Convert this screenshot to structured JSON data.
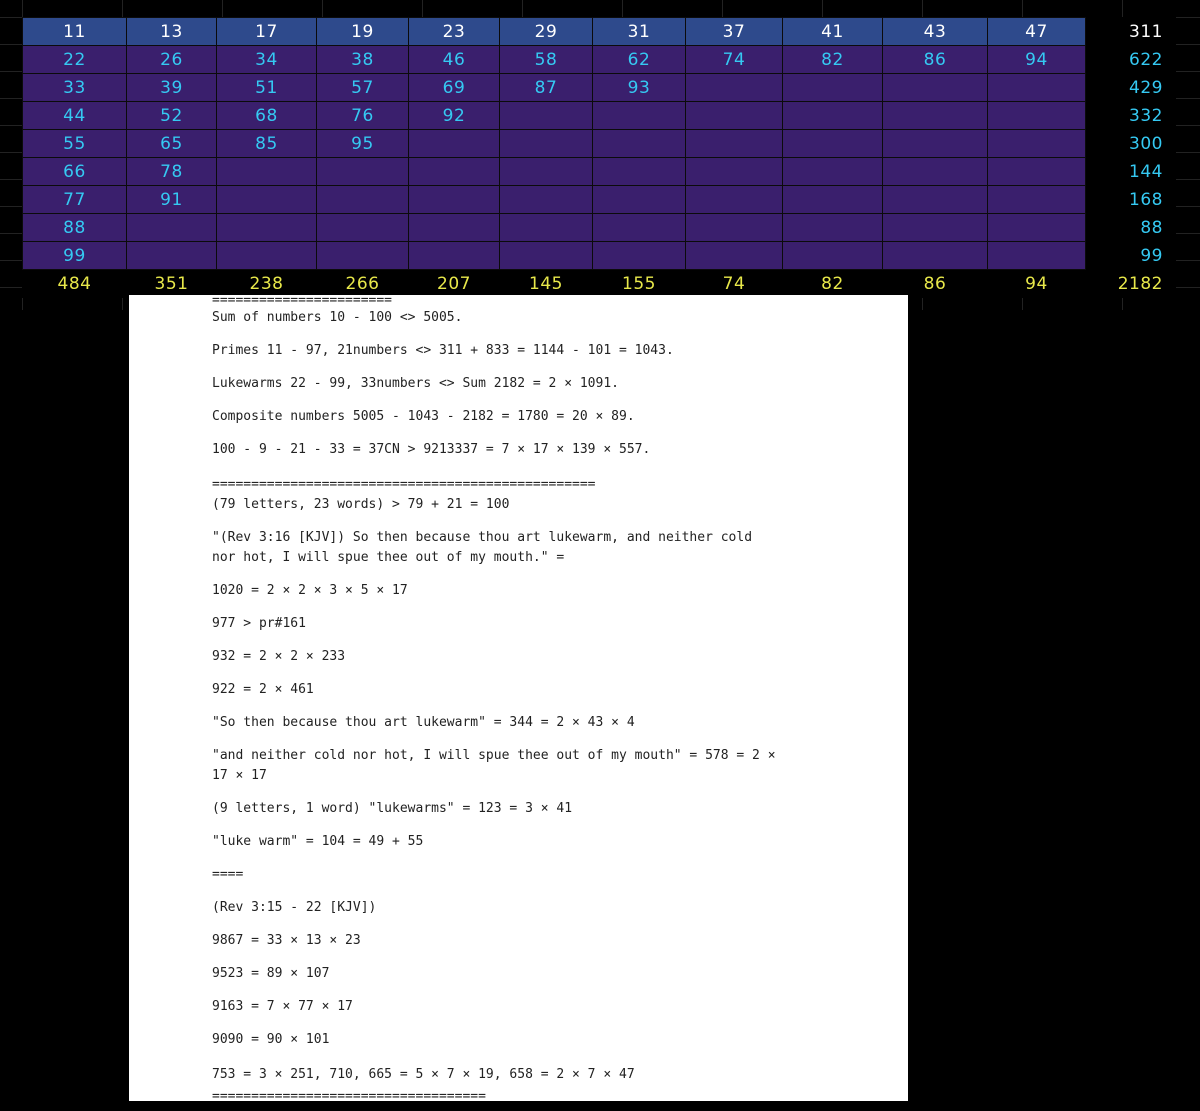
{
  "sheet": {
    "header": [
      "11",
      "13",
      "17",
      "19",
      "23",
      "29",
      "31",
      "37",
      "41",
      "43",
      "47",
      "311"
    ],
    "rows": [
      [
        "22",
        "26",
        "34",
        "38",
        "46",
        "58",
        "62",
        "74",
        "82",
        "86",
        "94",
        "622"
      ],
      [
        "33",
        "39",
        "51",
        "57",
        "69",
        "87",
        "93",
        "",
        "",
        "",
        "",
        "429"
      ],
      [
        "44",
        "52",
        "68",
        "76",
        "92",
        "",
        "",
        "",
        "",
        "",
        "",
        "332"
      ],
      [
        "55",
        "65",
        "85",
        "95",
        "",
        "",
        "",
        "",
        "",
        "",
        "",
        "300"
      ],
      [
        "66",
        "78",
        "",
        "",
        "",
        "",
        "",
        "",
        "",
        "",
        "",
        "144"
      ],
      [
        "77",
        "91",
        "",
        "",
        "",
        "",
        "",
        "",
        "",
        "",
        "",
        "168"
      ],
      [
        "88",
        "",
        "",
        "",
        "",
        "",
        "",
        "",
        "",
        "",
        "",
        "88"
      ],
      [
        "99",
        "",
        "",
        "",
        "",
        "",
        "",
        "",
        "",
        "",
        "",
        "99"
      ]
    ],
    "sums": [
      "484",
      "351",
      "238",
      "266",
      "207",
      "145",
      "155",
      "74",
      "82",
      "86",
      "94",
      "2182"
    ]
  },
  "doc": {
    "lines": [
      "=======================",
      "Sum of numbers 10 - 100 <> 5005.",
      "Primes 11 - 97, 21numbers <> 311 + 833 = 1144 - 101 = 1043.",
      "Lukewarms 22 - 99, 33numbers <> Sum 2182 = 2 × 1091.",
      "Composite numbers 5005 - 1043 - 2182 = 1780 = 20 × 89.",
      "100 - 9 - 21 - 33 = 37CN > 9213337 = 7 × 17 × 139 × 557.",
      "=================================================",
      "(79 letters, 23 words) > 79 + 21 = 100",
      "\"(Rev 3:16 [KJV]) So then because thou art lukewarm, and neither cold",
      "nor hot, I will spue thee out of my mouth.\" =",
      "1020 = 2 × 2 × 3 × 5 × 17",
      "977 > pr#161",
      "932 = 2 × 2 × 233",
      "922 = 2 × 461",
      "\"So then because thou art lukewarm\" = 344 = 2 × 43 × 4",
      "\"and neither cold nor hot, I will spue thee out of my mouth\" = 578 = 2 ×",
      "17 × 17",
      "(9 letters, 1 word) \"lukewarms\" = 123 = 3 × 41",
      "\"luke warm\" = 104 = 49 + 55",
      "====",
      "(Rev 3:15 - 22 [KJV])",
      "9867 = 33 × 13 × 23",
      "9523 = 89 × 107",
      "9163 = 7 × 77 × 17",
      "9090 = 90 × 101",
      "753 = 3 × 251, 710, 665 = 5 × 7 × 19, 658 = 2 × 7 × 47",
      "==================================="
    ]
  }
}
